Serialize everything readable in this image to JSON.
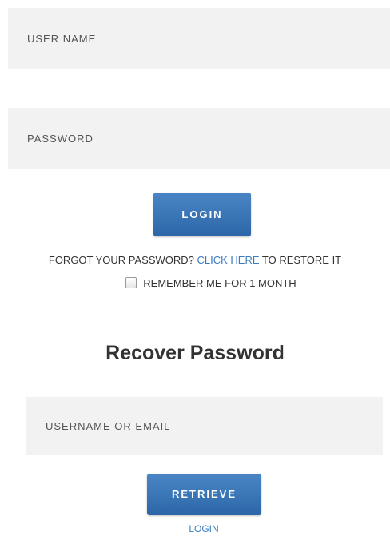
{
  "login_form": {
    "username_placeholder": "USER NAME",
    "password_placeholder": "PASSWORD",
    "login_button": "LOGIN"
  },
  "forgot": {
    "prefix": "FORGOT YOUR PASSWORD? ",
    "link": "CLICK HERE",
    "suffix": " TO RESTORE IT"
  },
  "remember": {
    "label": "REMEMBER ME FOR 1 MONTH",
    "checked": false
  },
  "recover": {
    "heading": "Recover Password",
    "input_placeholder": "USERNAME OR EMAIL",
    "button": "RETRIEVE",
    "login_link": "LOGIN"
  },
  "colors": {
    "button_top": "#4a86c5",
    "button_bottom": "#2c66a8",
    "link": "#3a7cc0",
    "field_bg": "#f2f2f2"
  }
}
